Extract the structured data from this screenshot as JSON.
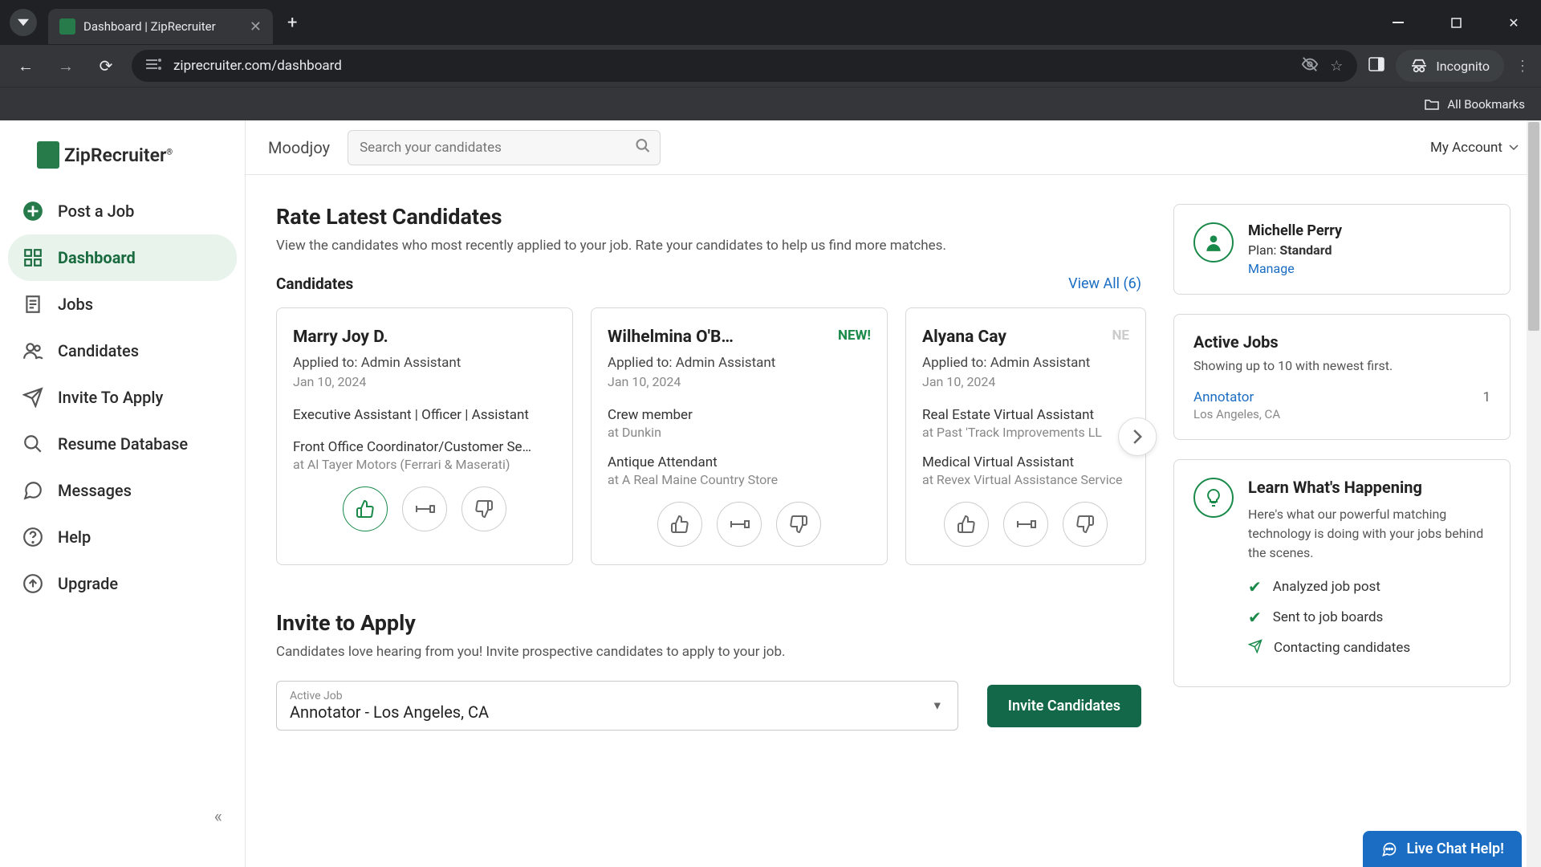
{
  "browser": {
    "tab_title": "Dashboard | ZipRecruiter",
    "url": "ziprecruiter.com/dashboard",
    "incognito": "Incognito",
    "all_bookmarks": "All Bookmarks"
  },
  "logo_text": "ZipRecruiter",
  "sidebar": {
    "items": [
      {
        "label": "Post a Job"
      },
      {
        "label": "Dashboard"
      },
      {
        "label": "Jobs"
      },
      {
        "label": "Candidates"
      },
      {
        "label": "Invite To Apply"
      },
      {
        "label": "Resume Database"
      },
      {
        "label": "Messages"
      },
      {
        "label": "Help"
      },
      {
        "label": "Upgrade"
      }
    ]
  },
  "topbar": {
    "org": "Moodjoy",
    "search_placeholder": "Search your candidates",
    "account": "My Account"
  },
  "rate": {
    "title": "Rate Latest Candidates",
    "sub": "View the candidates who most recently applied to your job. Rate your candidates to help us find more matches.",
    "cand_label": "Candidates",
    "view_all": "View All (6)"
  },
  "cards": [
    {
      "name": "Marry Joy D.",
      "applied": "Applied to: Admin Assistant",
      "date": "Jan 10, 2024",
      "exp1": "Executive Assistant | Officer | Assistant",
      "sub1": "",
      "exp2": "Front Office Coordinator/Customer Se…",
      "sub2": "at Al Tayer Motors (Ferrari & Maserati)",
      "new": ""
    },
    {
      "name": "Wilhelmina O'B…",
      "applied": "Applied to: Admin Assistant",
      "date": "Jan 10, 2024",
      "exp1": "Crew member",
      "sub1": "at Dunkin",
      "exp2": "Antique Attendant",
      "sub2": "at A Real Maine Country Store",
      "new": "NEW!"
    },
    {
      "name": "Alyana Cay",
      "applied": "Applied to: Admin Assistant",
      "date": "Jan 10, 2024",
      "exp1": "Real Estate Virtual Assistant",
      "sub1": "at Past 'Track Improvements LL",
      "exp2": "Medical Virtual Assistant",
      "sub2": "at Revex Virtual Assistance Service",
      "new": "NE"
    }
  ],
  "invite": {
    "title": "Invite to Apply",
    "sub": "Candidates love hearing from you! Invite prospective candidates to apply to your job.",
    "select_label": "Active Job",
    "select_value": "Annotator - Los Angeles, CA",
    "button": "Invite Candidates"
  },
  "profile": {
    "name": "Michelle Perry",
    "plan_label": "Plan: ",
    "plan_value": "Standard",
    "manage": "Manage"
  },
  "active_jobs": {
    "title": "Active Jobs",
    "sub": "Showing up to 10 with newest first.",
    "job_name": "Annotator",
    "job_loc": "Los Angeles, CA",
    "job_count": "1"
  },
  "learn": {
    "title": "Learn What's Happening",
    "sub": "Here's what our powerful matching technology is doing with your jobs behind the scenes.",
    "items": [
      "Analyzed job post",
      "Sent to job boards",
      "Contacting candidates"
    ]
  },
  "chat": "Live Chat Help!"
}
